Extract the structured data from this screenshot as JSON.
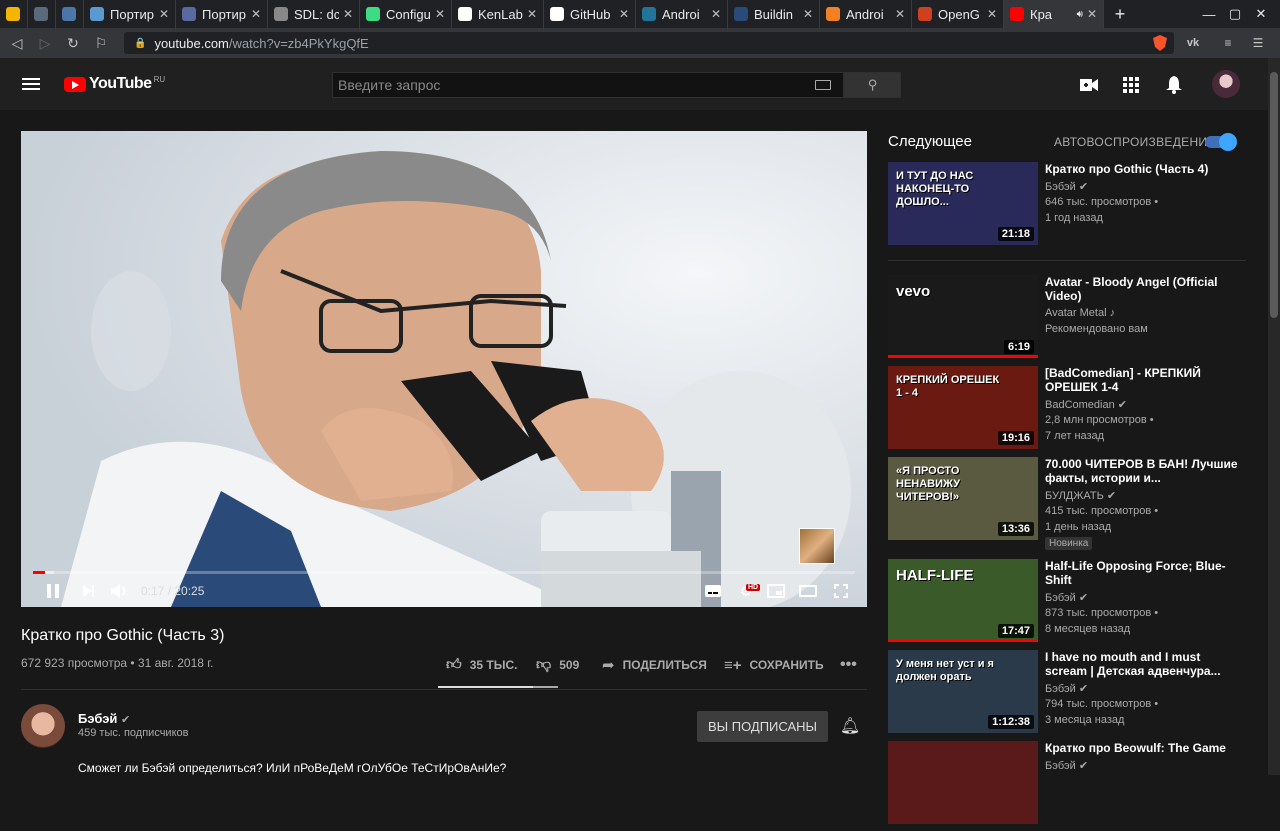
{
  "browser": {
    "tabs": [
      {
        "title": "",
        "icon": "drive-icon",
        "color": "#f4b400",
        "w": 28
      },
      {
        "title": "",
        "icon": "habr-icon",
        "color": "#5a6a7a",
        "w": 28
      },
      {
        "title": "",
        "icon": "vk-icon",
        "color": "#4a76a8",
        "w": 28
      },
      {
        "title": "Портир",
        "icon": "site-icon",
        "color": "#5a9ad0",
        "w": 92
      },
      {
        "title": "Портир",
        "icon": "e-icon",
        "color": "#5a6aa0",
        "w": 92
      },
      {
        "title": "SDL: dc",
        "icon": "sdl-icon",
        "color": "#888",
        "w": 92
      },
      {
        "title": "Configu",
        "icon": "android-icon",
        "color": "#3ddc84",
        "w": 92
      },
      {
        "title": "KenLab",
        "icon": "github-icon",
        "color": "#fff",
        "w": 92
      },
      {
        "title": "GitHub",
        "icon": "github-icon",
        "color": "#fff",
        "w": 92
      },
      {
        "title": "Androi",
        "icon": "wordpress-icon",
        "color": "#21759b",
        "w": 92
      },
      {
        "title": "Buildin",
        "icon": "site-icon",
        "color": "#2a4a7a",
        "w": 92
      },
      {
        "title": "Androi",
        "icon": "stackoverflow-icon",
        "color": "#f48024",
        "w": 92
      },
      {
        "title": "OpenG",
        "icon": "code-icon",
        "color": "#d04020",
        "w": 92
      },
      {
        "title": "Кра",
        "icon": "youtube-icon",
        "color": "#f00",
        "w": 100,
        "active": true
      }
    ],
    "url_host": "youtube.com",
    "url_path": "/watch?v=zb4PkYkgQfE"
  },
  "yt": {
    "logo_text": "YouTube",
    "region": "RU",
    "search_placeholder": "Введите запрос"
  },
  "video": {
    "time": "0:17 / 20:25",
    "progress": 0.014,
    "title": "Кратко про Gothic (Часть 3)",
    "meta": "672 923 просмотра • 31 авг. 2018 г.",
    "likes": "35 ТЫС.",
    "dislikes": "509",
    "like_ratio": 0.986,
    "share": "ПОДЕЛИТЬСЯ",
    "save": "СОХРАНИТЬ"
  },
  "channel": {
    "name": "Бэбэй",
    "subs": "459 тыс. подписчиков",
    "subscribed_label": "ВЫ ПОДПИСАНЫ",
    "desc": "Сможет ли Бэбэй определиться? ИлИ пРоВеДеМ гОлУбОе ТеСтИрОвАнИе?"
  },
  "sidebar": {
    "next_label": "Следующее",
    "autoplay_label": "АВТОВОСПРОИЗВЕДЕНИЕ",
    "videos": [
      {
        "title": "Кратко про Gothic (Часть 4)",
        "channel": "Бэбэй",
        "views": "646 тыс. просмотров •",
        "age": "1 год назад",
        "duration": "21:18",
        "thumb_text": "И ТУТ ДО НАС НАКОНЕЦ-ТО ДОШЛО...",
        "bg": "#2a2a5a",
        "verified": true
      },
      {
        "title": "Avatar - Bloody Angel (Official Video)",
        "channel": "Avatar Metal",
        "views": "",
        "age": "Рекомендовано вам",
        "duration": "6:19",
        "thumb_text": "vevo",
        "bg": "#1a1a1a",
        "watched": 1.0,
        "note": true
      },
      {
        "title": "[BadComedian] - КРЕПКИЙ ОРЕШЕК 1-4",
        "channel": "BadComedian",
        "views": "2,8 млн просмотров •",
        "age": "7 лет назад",
        "duration": "19:16",
        "thumb_text": "КРЕПКИЙ ОРЕШЕК 1 - 4",
        "bg": "#6a1a10",
        "verified": true
      },
      {
        "title": "70.000 ЧИТЕРОВ В БАН! Лучшие факты, истории и...",
        "channel": "БУЛДЖАТЬ",
        "views": "415 тыс. просмотров •",
        "age": "1 день назад",
        "badge": "Новинка",
        "duration": "13:36",
        "thumb_text": "«Я ПРОСТО НЕНАВИЖУ ЧИТЕРОВ!»",
        "bg": "#5a5a40",
        "verified": true
      },
      {
        "title": "Half-Life Opposing Force; Blue-Shift",
        "channel": "Бэбэй",
        "views": "873 тыс. просмотров •",
        "age": "8 месяцев назад",
        "duration": "17:47",
        "thumb_text": "HALF-LIFE",
        "bg": "#3a5a2a",
        "watched": 1.0,
        "verified": true
      },
      {
        "title": "I have no mouth and I must scream | Детская адвенчура...",
        "channel": "Бэбэй",
        "views": "794 тыс. просмотров •",
        "age": "3 месяца назад",
        "duration": "1:12:38",
        "thumb_text": "У меня нет уст и я должен орать",
        "bg": "#2a3a4a",
        "verified": true
      },
      {
        "title": "Кратко про Beowulf: The Game",
        "channel": "Бэбэй",
        "views": "",
        "age": "",
        "duration": "",
        "thumb_text": "",
        "bg": "#5a1a1a",
        "verified": true
      }
    ]
  }
}
